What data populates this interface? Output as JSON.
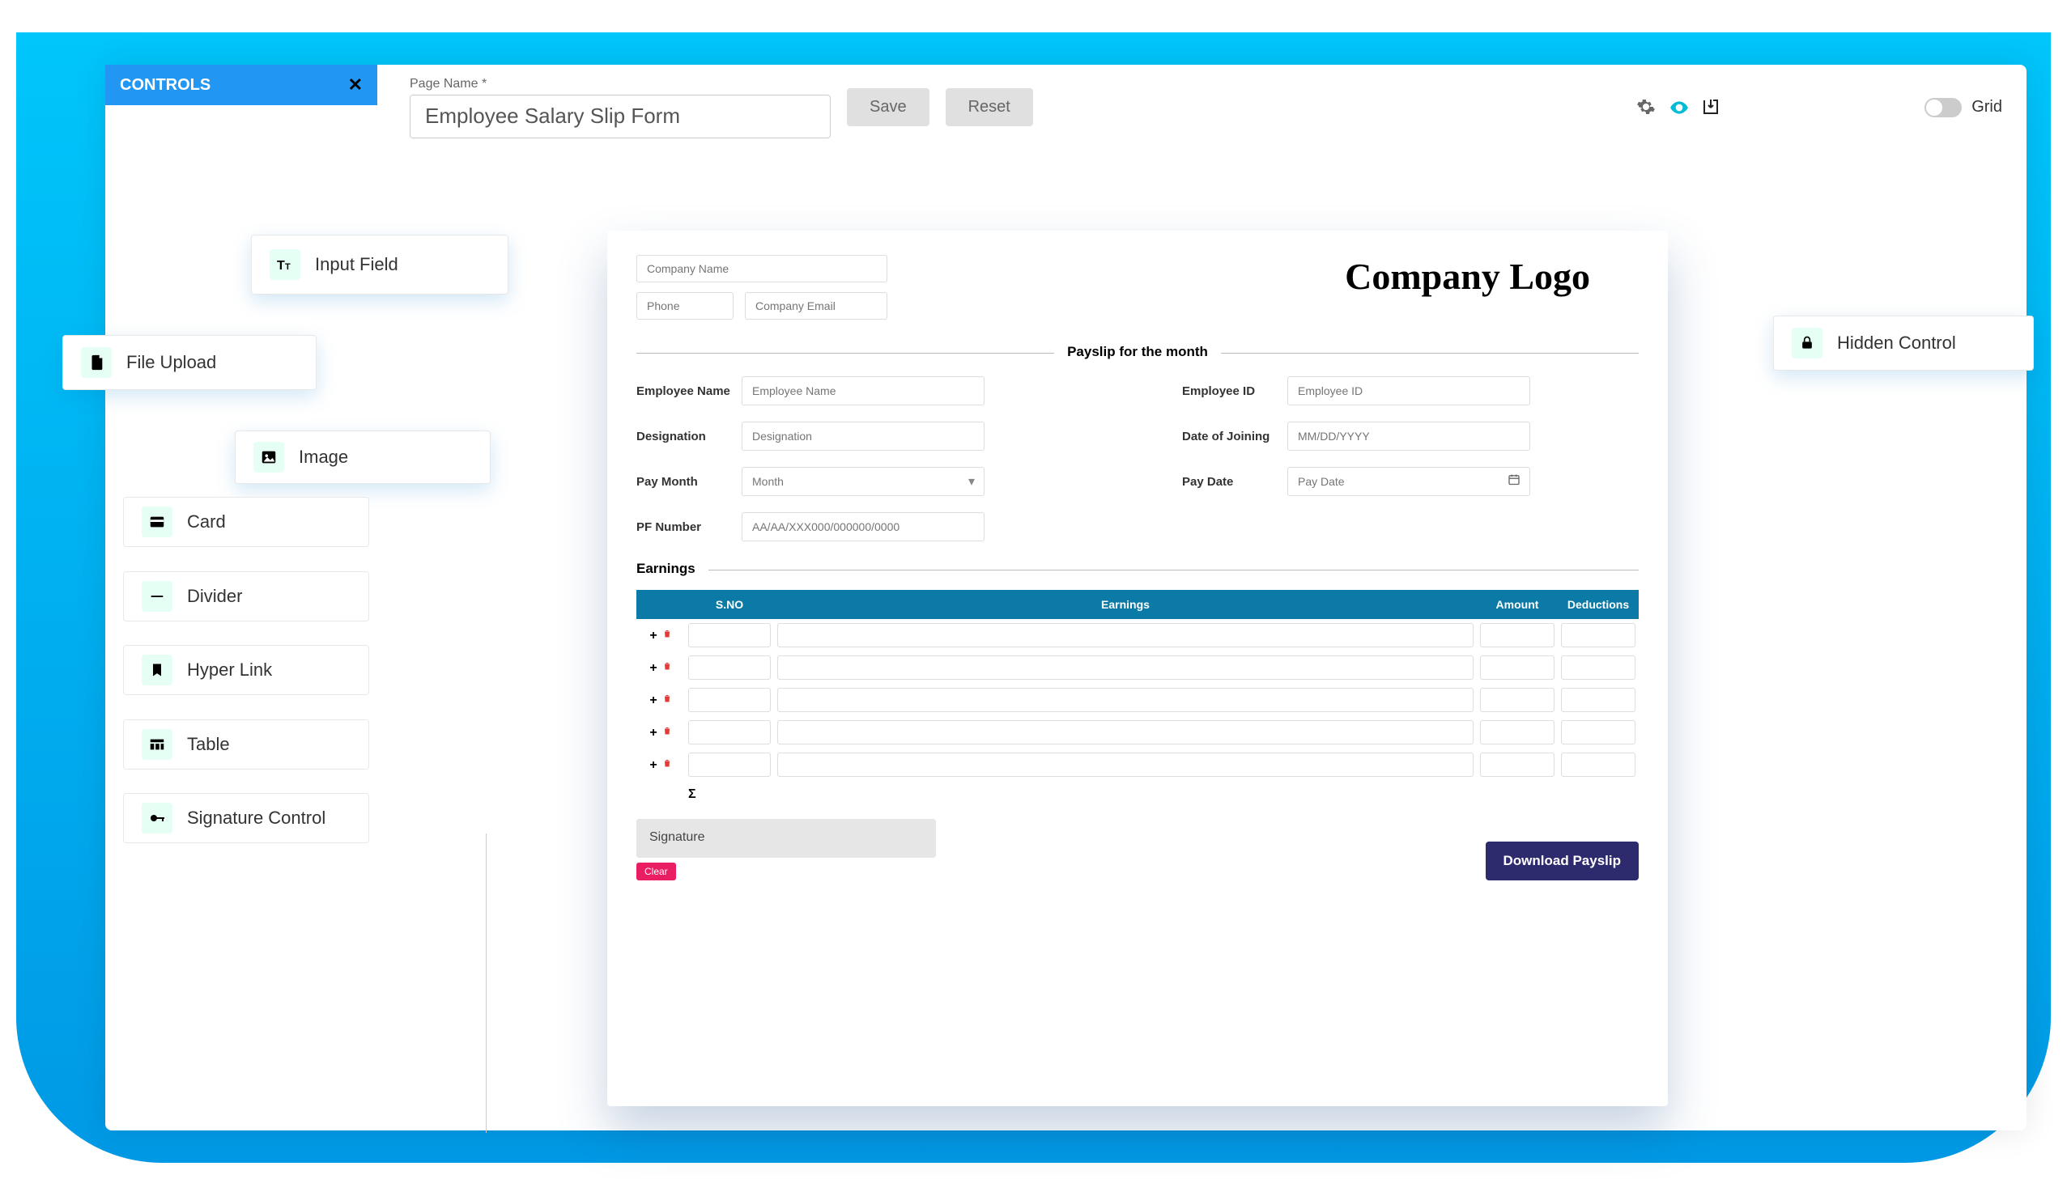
{
  "controls_panel": {
    "title": "CONTROLS"
  },
  "toolbar": {
    "page_name_label": "Page Name *",
    "page_name_value": "Employee Salary Slip Form",
    "save_label": "Save",
    "reset_label": "Reset",
    "grid_label": "Grid"
  },
  "control_cards": {
    "input_field": "Input Field",
    "file_upload": "File Upload",
    "image": "Image",
    "card": "Card",
    "divider": "Divider",
    "hyper_link": "Hyper Link",
    "table": "Table",
    "signature_control": "Signature Control",
    "hidden_control": "Hidden Control"
  },
  "form": {
    "company_name_ph": "Company Name",
    "phone_ph": "Phone",
    "company_email_ph": "Company Email",
    "company_logo_text": "Company Logo",
    "payslip_section_title": "Payslip for the month",
    "fields": {
      "employee_name": {
        "label": "Employee Name",
        "ph": "Employee Name"
      },
      "employee_id": {
        "label": "Employee ID",
        "ph": "Employee ID"
      },
      "designation": {
        "label": "Designation",
        "ph": "Designation"
      },
      "date_of_joining": {
        "label": "Date of Joining",
        "ph": "MM/DD/YYYY"
      },
      "pay_month": {
        "label": "Pay Month",
        "ph": "Month"
      },
      "pay_date": {
        "label": "Pay Date",
        "ph": "Pay Date"
      },
      "pf_number": {
        "label": "PF Number",
        "ph": "AA/AA/XXX000/000000/0000"
      }
    },
    "earnings_title": "Earnings",
    "table_headers": {
      "sno": "S.NO",
      "earnings": "Earnings",
      "amount": "Amount",
      "deductions": "Deductions"
    },
    "table_rows": 5,
    "sigma": "Σ",
    "signature_label": "Signature",
    "clear_label": "Clear",
    "download_label": "Download Payslip"
  }
}
